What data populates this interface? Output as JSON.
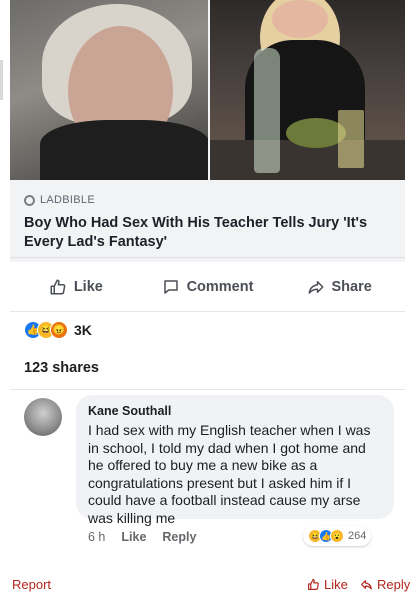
{
  "post": {
    "source": "LADBIBLE",
    "headline": "Boy Who Had Sex With His Teacher Tells Jury 'It's Every Lad's Fantasy'"
  },
  "actions": {
    "like": "Like",
    "comment": "Comment",
    "share": "Share"
  },
  "reactions": {
    "count": "3K",
    "icons": [
      "like-icon",
      "haha-icon",
      "angry-icon"
    ]
  },
  "shares": "123 shares",
  "comment": {
    "author": "Kane Southall",
    "text": "I had sex with my English teacher when I was in school, I told my dad when I got home and he offered to buy me a new bike as a congratulations present but I asked him if I could have a football instead cause my arse was killing me",
    "time": "6 h",
    "like": "Like",
    "reply": "Reply",
    "reaction_count": "264",
    "reaction_icons": [
      "haha-icon",
      "like-icon",
      "wow-icon"
    ]
  },
  "footer": {
    "report": "Report",
    "like": "Like",
    "reply": "Reply"
  },
  "colors": {
    "facebook_blue": "#1877f2",
    "footer_red": "#b3261e",
    "comment_bubble": "#f0f2f5"
  }
}
